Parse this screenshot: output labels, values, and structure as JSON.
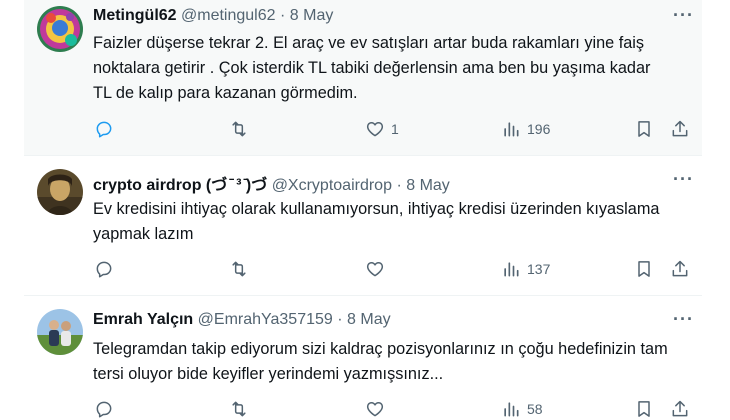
{
  "tweets": [
    {
      "name": "Metingül62",
      "handle": "@metingul62",
      "separator": "·",
      "date": "8 May",
      "more": "···",
      "text": "Faizler düşerse tekrar 2. El araç ve ev satışları artar buda rakamları yine faiş noktalara getirir . Çok isterdik TL tabiki değerlensin ama ben bu yaşıma kadar TL de kalıp para kazanan görmedim.",
      "likes": "1",
      "views": "196",
      "reply_icon": "reply-icon",
      "retweet_icon": "retweet-icon",
      "like_icon": "heart-icon",
      "views_icon": "bar-chart-icon",
      "bookmark_icon": "bookmark-icon",
      "share_icon": "share-icon"
    },
    {
      "name": "crypto airdrop (づ ̄ ³ ̄)づ",
      "handle": "@Xcryptoairdrop",
      "separator": "·",
      "date": "8 May",
      "more": "···",
      "text": "Ev kredisini ihtiyaç olarak kullanamıyorsun, ihtiyaç kredisi üzerinden kıyaslama yapmak lazım",
      "likes": "",
      "views": "137"
    },
    {
      "name": "Emrah Yalçın",
      "handle": "@EmrahYa357159",
      "separator": "·",
      "date": "8 May",
      "more": "···",
      "text": "Telegramdan takip ediyorum sizi kaldraç pozisyonlarınız ın çoğu hedefinizin tam tersi oluyor bide keyifler yerindemi yazmışsınız...",
      "likes": "",
      "views": "58"
    }
  ],
  "colors": {
    "name": "#0f1419",
    "secondary": "#536471",
    "reply_active": "#1d9bf0",
    "highlight_bg": "#f7f9f9",
    "divider": "#eff3f4"
  }
}
